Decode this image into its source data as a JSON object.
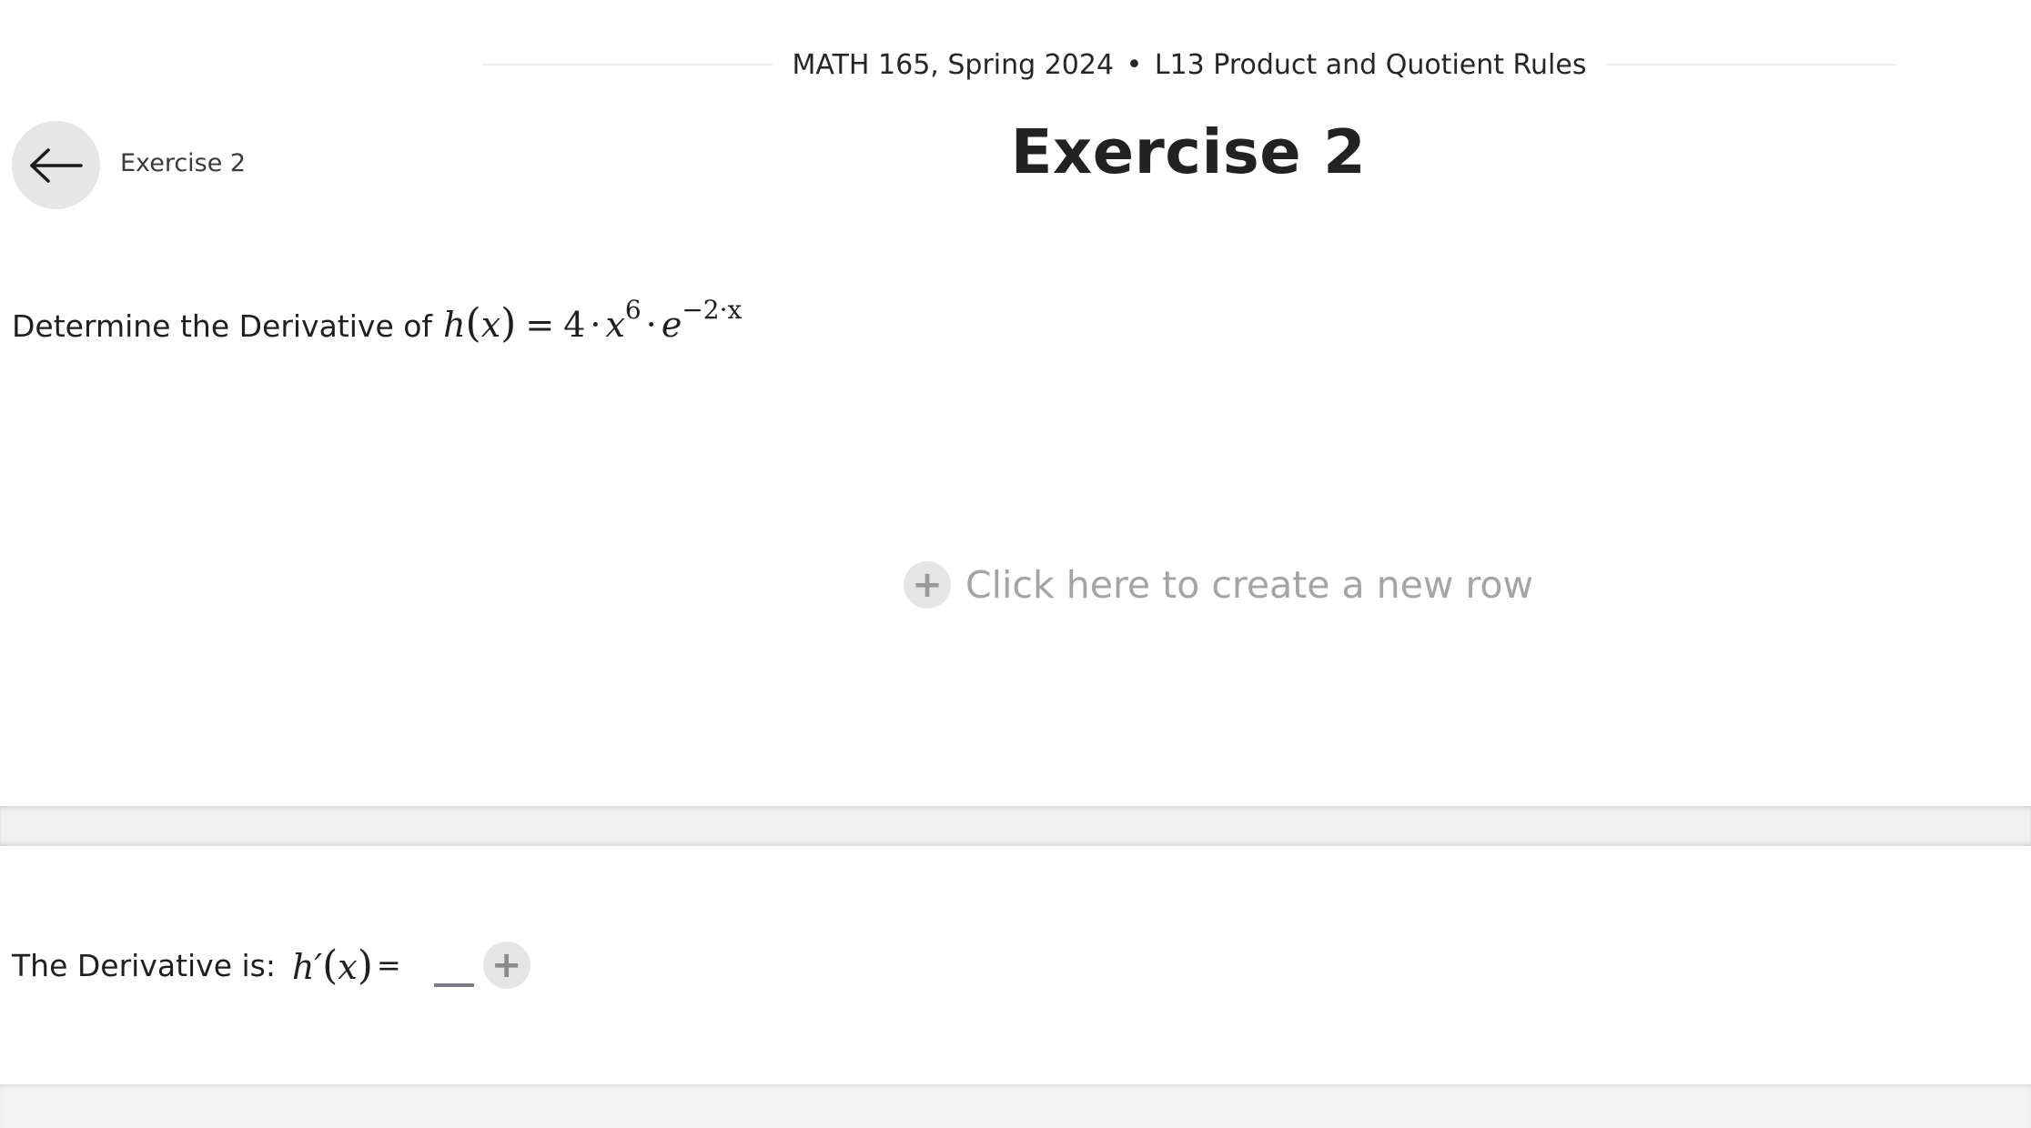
{
  "header": {
    "course": "MATH 165, Spring 2024",
    "separator": "•",
    "lesson": "L13 Product and Quotient Rules"
  },
  "nav": {
    "back_icon": "arrow-left-icon",
    "breadcrumb": "Exercise 2"
  },
  "page_title": "Exercise 2",
  "problem": {
    "prompt": "Determine the Derivative of",
    "fn_name": "h",
    "fn_var": "x",
    "coefficient": "4",
    "base": "x",
    "exponent": "6",
    "exp_base": "e",
    "exp_power": "−2·x"
  },
  "new_row": {
    "icon": "plus-icon",
    "label": "Click here to create a new row"
  },
  "answer": {
    "prompt": "The Derivative is:",
    "fn_name": "h′",
    "fn_var": "x",
    "equals": "=",
    "add_icon": "plus-icon"
  }
}
